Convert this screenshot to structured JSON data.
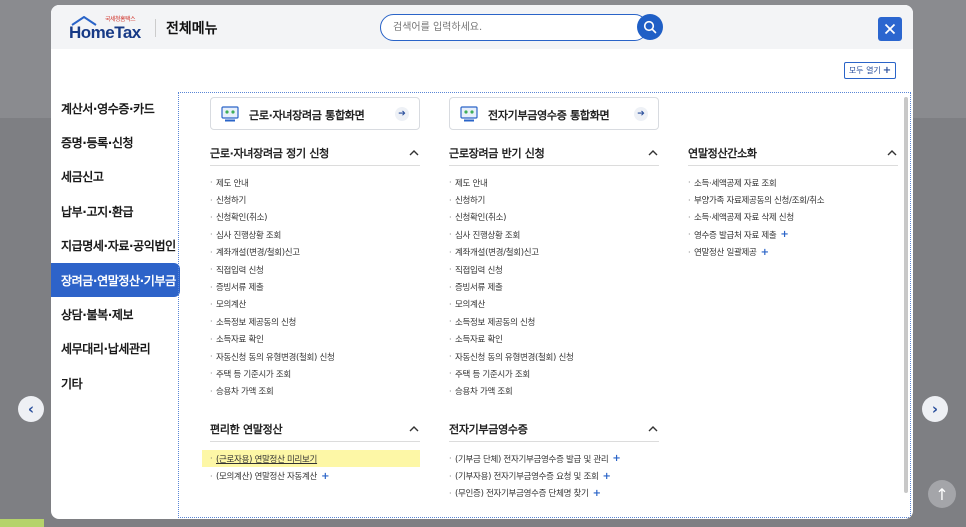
{
  "header": {
    "logo_small": "국세청홈택스",
    "logo_big": "HomeTax",
    "title": "전체메뉴",
    "search_placeholder": "검색어를 입력하세요."
  },
  "open_all_label": "모두 열기",
  "sidebar": {
    "items": [
      {
        "label": "계산서·영수증·카드",
        "active": false
      },
      {
        "label": "증명·등록·신청",
        "active": false
      },
      {
        "label": "세금신고",
        "active": false
      },
      {
        "label": "납부·고지·환급",
        "active": false
      },
      {
        "label": "지급명세·자료·공익법인",
        "active": false
      },
      {
        "label": "장려금·연말정산·기부금",
        "active": true
      },
      {
        "label": "상담·불복·제보",
        "active": false
      },
      {
        "label": "세무대리·납세관리",
        "active": false
      },
      {
        "label": "기타",
        "active": false
      }
    ]
  },
  "quick_links": [
    {
      "label": "근로·자녀장려금 통합화면"
    },
    {
      "label": "전자기부금영수증 통합화면"
    }
  ],
  "sections": [
    {
      "title": "근로·자녀장려금 정기 신청",
      "links": [
        {
          "label": "제도 안내"
        },
        {
          "label": "신청하기"
        },
        {
          "label": "신청확인(취소)"
        },
        {
          "label": "심사 진행상황 조회"
        },
        {
          "label": "계좌개설(변경/철회)신고"
        },
        {
          "label": "직접입력 신청"
        },
        {
          "label": "증빙서류 제출"
        },
        {
          "label": "모의계산"
        },
        {
          "label": "소득정보 제공동의 신청"
        },
        {
          "label": "소득자료 확인"
        },
        {
          "label": "자동신청 동의 유형변경(철회) 신청"
        },
        {
          "label": "주택 등 기준시가 조회"
        },
        {
          "label": "승용차 가액 조회"
        }
      ]
    },
    {
      "title": "근로장려금 반기 신청",
      "links": [
        {
          "label": "제도 안내"
        },
        {
          "label": "신청하기"
        },
        {
          "label": "신청확인(취소)"
        },
        {
          "label": "심사 진행상황 조회"
        },
        {
          "label": "계좌개설(변경/철회)신고"
        },
        {
          "label": "직접입력 신청"
        },
        {
          "label": "증빙서류 제출"
        },
        {
          "label": "모의계산"
        },
        {
          "label": "소득정보 제공동의 신청"
        },
        {
          "label": "소득자료 확인"
        },
        {
          "label": "자동신청 동의 유형변경(철회) 신청"
        },
        {
          "label": "주택 등 기준시가 조회"
        },
        {
          "label": "승용차 가액 조회"
        }
      ]
    },
    {
      "title": "연말정산간소화",
      "links": [
        {
          "label": "소득·세액공제 자료 조회"
        },
        {
          "label": "부양가족 자료제공동의 신청/조회/취소"
        },
        {
          "label": "소득·세액공제 자료 삭제 신청"
        },
        {
          "label": "영수증 발급처 자료 제출",
          "plus": true
        },
        {
          "label": "연말정산 일괄제공",
          "plus": true
        }
      ]
    },
    {
      "title": "편리한 연말정산",
      "links": [
        {
          "label": "(근로자용) 연말정산 미리보기",
          "highlight": true
        },
        {
          "label": "(모의계산) 연말정산 자동계산",
          "plus": true
        }
      ]
    },
    {
      "title": "전자기부금영수증",
      "links": [
        {
          "label": "(기부금 단체) 전자기부금영수증 발급 및 관리",
          "plus": true
        },
        {
          "label": "(기부자용) 전자기부금영수증 요청 및 조회",
          "plus": true
        },
        {
          "label": "(무인증) 전자기부금영수증 단체명 찾기",
          "plus": true
        }
      ]
    }
  ],
  "colors": {
    "accent": "#2d63c9",
    "highlight": "#fdf7a6",
    "overlay": "#7e7f83"
  }
}
